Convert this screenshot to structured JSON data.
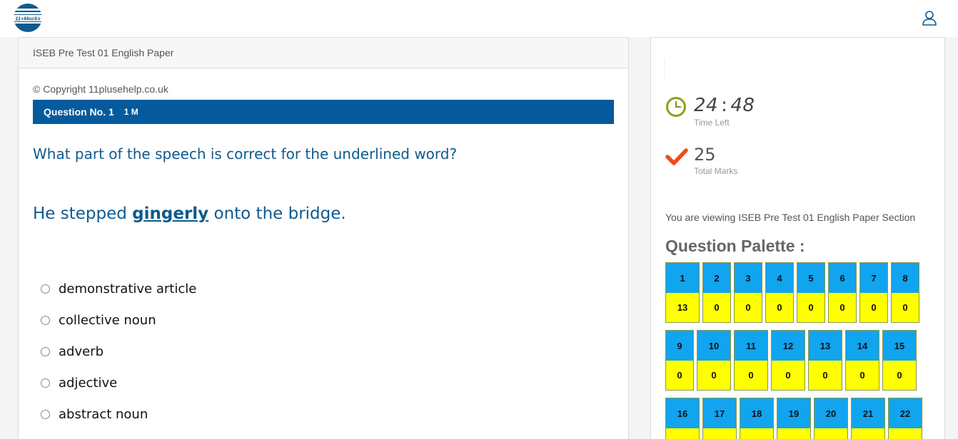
{
  "header": {
    "logo_text": "11+Mocks",
    "user_icon": "user-icon"
  },
  "paper": {
    "title": "ISEB Pre Test 01 English Paper",
    "copyright": "© Copyright 11plusehelp.co.uk",
    "question_number": "Question No. 1",
    "question_marks": "1 M",
    "question_text": "What part of the speech is correct for the underlined word?",
    "sentence_before": "He stepped ",
    "sentence_underlined": "gingerly",
    "sentence_after": " onto the bridge.",
    "options": [
      "demonstrative article",
      "collective noun",
      "adverb",
      "adjective",
      "abstract noun"
    ]
  },
  "sidebar": {
    "timer_minutes": "24",
    "timer_separator": ":",
    "timer_seconds": "48",
    "time_left_label": "Time Left",
    "total_marks": "25",
    "total_marks_label": "Total Marks",
    "viewing_text": "You are viewing ISEB Pre Test 01 English Paper Section",
    "palette_title": "Question Palette :",
    "palette": [
      {
        "num": "1",
        "val": "13"
      },
      {
        "num": "2",
        "val": "0"
      },
      {
        "num": "3",
        "val": "0"
      },
      {
        "num": "4",
        "val": "0"
      },
      {
        "num": "5",
        "val": "0"
      },
      {
        "num": "6",
        "val": "0"
      },
      {
        "num": "7",
        "val": "0"
      },
      {
        "num": "8",
        "val": "0"
      },
      {
        "num": "9",
        "val": "0"
      },
      {
        "num": "10",
        "val": "0"
      },
      {
        "num": "11",
        "val": "0"
      },
      {
        "num": "12",
        "val": "0"
      },
      {
        "num": "13",
        "val": "0"
      },
      {
        "num": "14",
        "val": "0"
      },
      {
        "num": "15",
        "val": "0"
      },
      {
        "num": "16",
        "val": ""
      },
      {
        "num": "17",
        "val": ""
      },
      {
        "num": "18",
        "val": ""
      },
      {
        "num": "19",
        "val": ""
      },
      {
        "num": "20",
        "val": ""
      },
      {
        "num": "21",
        "val": ""
      },
      {
        "num": "22",
        "val": ""
      }
    ]
  },
  "colors": {
    "primary_blue": "#045a9c",
    "question_text": "#0f5a8f",
    "palette_number_bg": "#11a4ef",
    "palette_value_bg": "#ffff00",
    "clock_green": "#8ca120",
    "check_orange": "#f04a18"
  }
}
